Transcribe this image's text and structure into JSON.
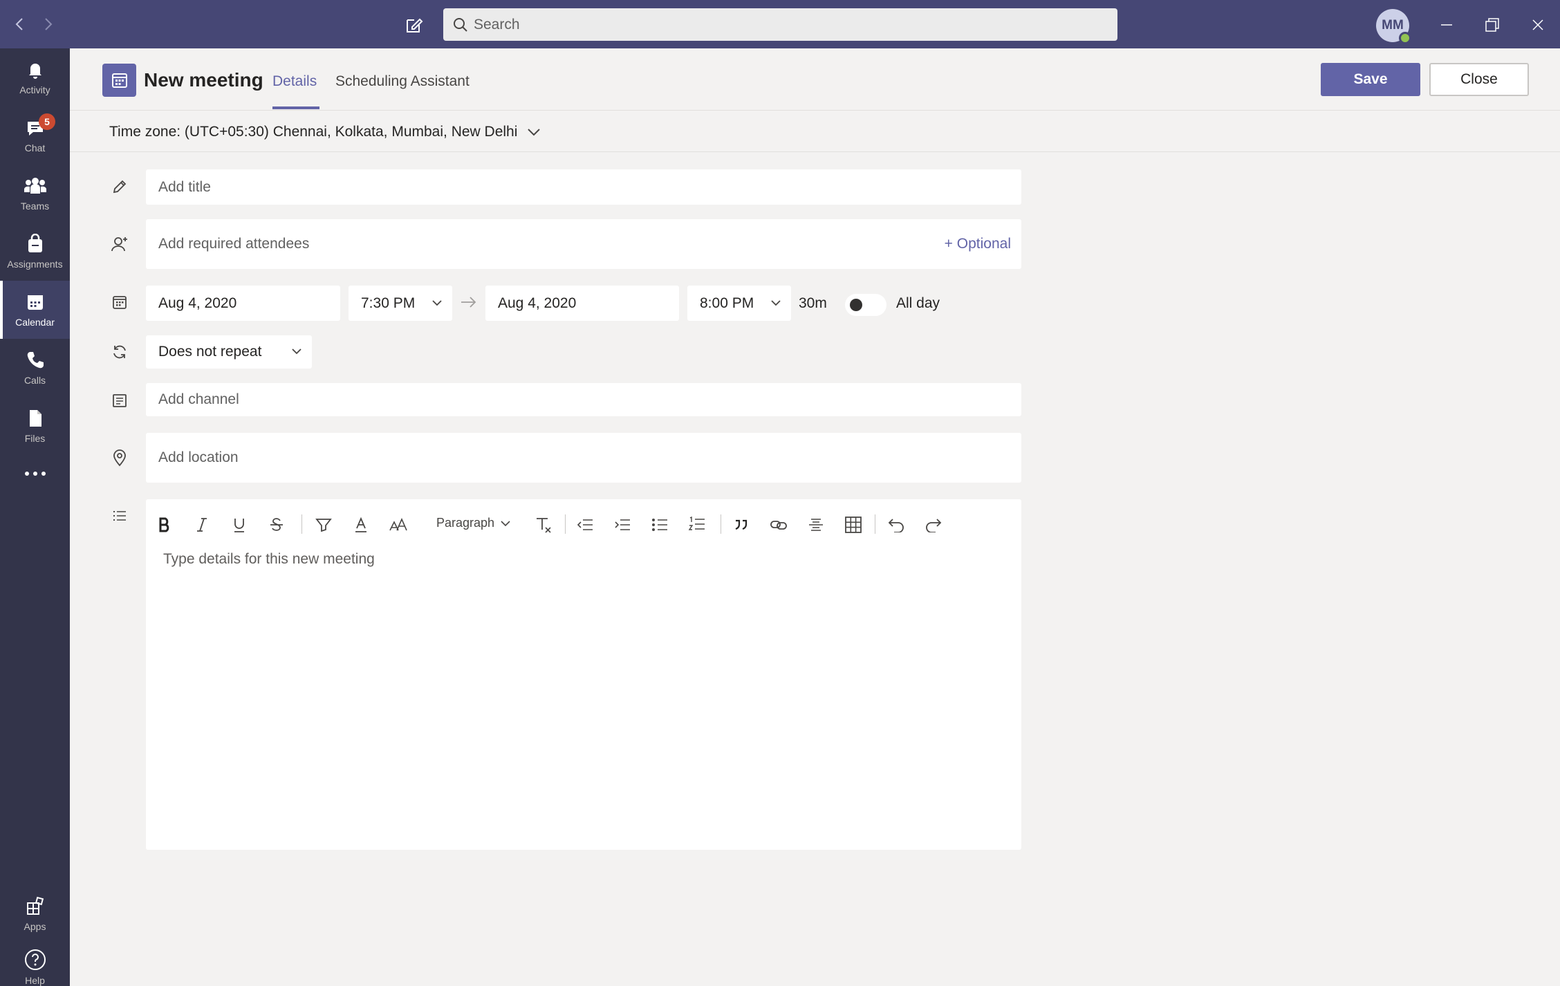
{
  "titlebar": {
    "search_placeholder": "Search",
    "avatar_initials": "MM"
  },
  "rail": {
    "items": [
      {
        "label": "Activity",
        "icon": "bell-icon"
      },
      {
        "label": "Chat",
        "icon": "chat-icon",
        "badge": "5"
      },
      {
        "label": "Teams",
        "icon": "teams-icon"
      },
      {
        "label": "Assignments",
        "icon": "assignments-icon"
      },
      {
        "label": "Calendar",
        "icon": "calendar-icon",
        "active": true
      },
      {
        "label": "Calls",
        "icon": "phone-icon"
      },
      {
        "label": "Files",
        "icon": "file-icon"
      }
    ],
    "bottom": [
      {
        "label": "Apps",
        "icon": "apps-icon"
      },
      {
        "label": "Help",
        "icon": "help-icon"
      }
    ]
  },
  "header": {
    "title": "New meeting",
    "tabs": [
      {
        "label": "Details",
        "active": true
      },
      {
        "label": "Scheduling Assistant"
      }
    ],
    "save_label": "Save",
    "close_label": "Close"
  },
  "timezone": {
    "label": "Time zone: (UTC+05:30) Chennai, Kolkata, Mumbai, New Delhi"
  },
  "form": {
    "title_placeholder": "Add title",
    "attendees_placeholder": "Add required attendees",
    "optional_label": "+ Optional",
    "start_date": "Aug 4, 2020",
    "start_time": "7:30 PM",
    "end_date": "Aug 4, 2020",
    "end_time": "8:00 PM",
    "duration": "30m",
    "all_day_label": "All day",
    "repeat": "Does not repeat",
    "channel_placeholder": "Add channel",
    "location_placeholder": "Add location",
    "details_placeholder": "Type details for this new meeting",
    "paragraph_label": "Paragraph"
  },
  "colors": {
    "titlebar": "#464775",
    "rail": "#33344a",
    "accent": "#6264a7",
    "badge": "#cc4a31",
    "presence": "#92c353"
  }
}
